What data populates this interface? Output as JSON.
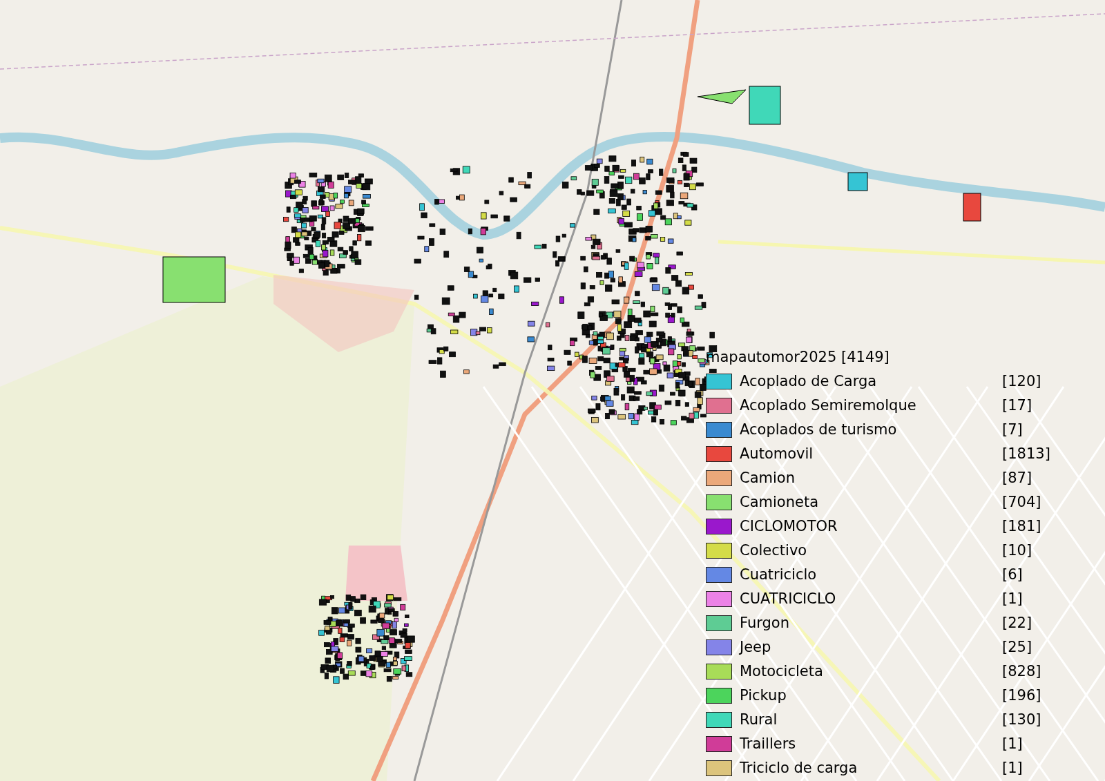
{
  "legend": {
    "title": "mapautomor2025 [4149]",
    "items": [
      {
        "label": "Acoplado de Carga",
        "count": "[120]",
        "color": "#35c4d4"
      },
      {
        "label": "Acoplado Semiremolque",
        "count": "[17]",
        "color": "#e07090"
      },
      {
        "label": "Acoplados de turismo",
        "count": "[7]",
        "color": "#3a8ad0"
      },
      {
        "label": "Automovil",
        "count": "[1813]",
        "color": "#e8483e"
      },
      {
        "label": "Camion",
        "count": "[87]",
        "color": "#eba87a"
      },
      {
        "label": "Camioneta",
        "count": "[704]",
        "color": "#88e070"
      },
      {
        "label": "CICLOMOTOR",
        "count": "[181]",
        "color": "#9a18cc"
      },
      {
        "label": "Colectivo",
        "count": "[10]",
        "color": "#d4dc48"
      },
      {
        "label": "Cuatriciclo",
        "count": "[6]",
        "color": "#6488e4"
      },
      {
        "label": "CUATRICICLO",
        "count": "[1]",
        "color": "#ec82e6"
      },
      {
        "label": "Furgon",
        "count": "[22]",
        "color": "#5ecc94"
      },
      {
        "label": "Jeep",
        "count": "[25]",
        "color": "#8484e8"
      },
      {
        "label": "Motocicleta",
        "count": "[828]",
        "color": "#a8dc58"
      },
      {
        "label": "Pickup",
        "count": "[196]",
        "color": "#4cd45c"
      },
      {
        "label": "Rural",
        "count": "[130]",
        "color": "#40d8b8"
      },
      {
        "label": "Traillers",
        "count": "[1]",
        "color": "#d03c98"
      },
      {
        "label": "Triciclo de carga",
        "count": "[1]",
        "color": "#dcc47c"
      }
    ]
  }
}
